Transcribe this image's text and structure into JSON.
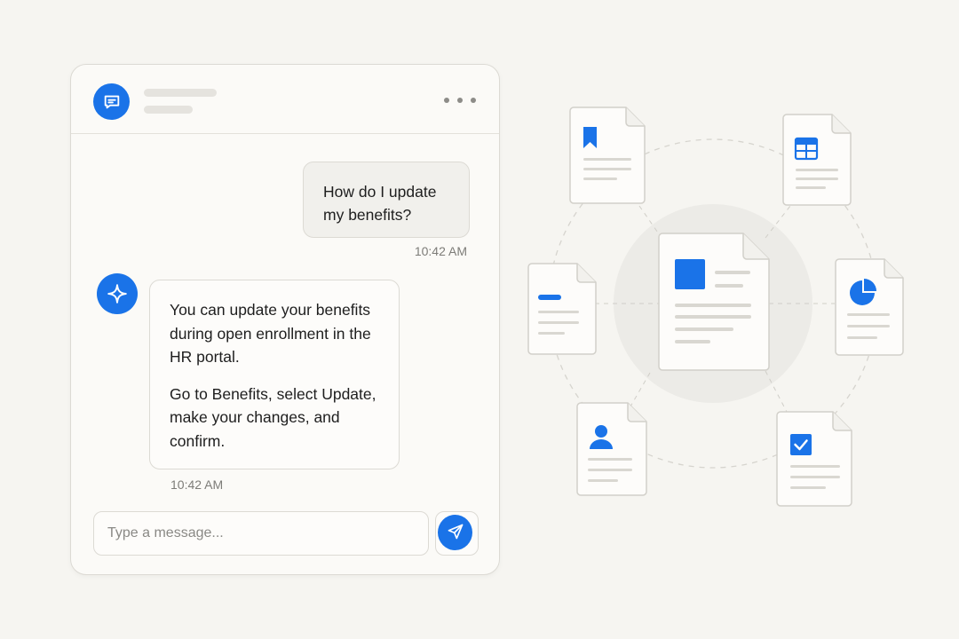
{
  "chat": {
    "header": {
      "avatar_icon": "chat-bubble-icon",
      "menu_icon": "more-horizontal-icon"
    },
    "messages": [
      {
        "role": "user",
        "text": "How do I update my benefits?",
        "time": "10:42 AM"
      },
      {
        "role": "assistant",
        "avatar_icon": "sparkle-icon",
        "paragraphs": [
          "You can update your benefits during open enrollment in the HR portal.",
          "Go to Benefits, select Update, make your changes, and confirm."
        ],
        "time": "10:42 AM"
      }
    ],
    "input": {
      "placeholder": "Type a message...",
      "value": ""
    },
    "send_icon": "send-icon"
  },
  "documents": {
    "center": {
      "icon": "blue-square-icon"
    },
    "satellites": [
      {
        "icon": "bookmark-icon"
      },
      {
        "icon": "table-icon"
      },
      {
        "icon": "minus-line-icon"
      },
      {
        "icon": "pie-chart-icon"
      },
      {
        "icon": "user-icon"
      },
      {
        "icon": "checkbox-icon"
      }
    ]
  },
  "colors": {
    "accent": "#1a73e8",
    "background": "#f6f5f1",
    "border": "#dcdad4"
  }
}
